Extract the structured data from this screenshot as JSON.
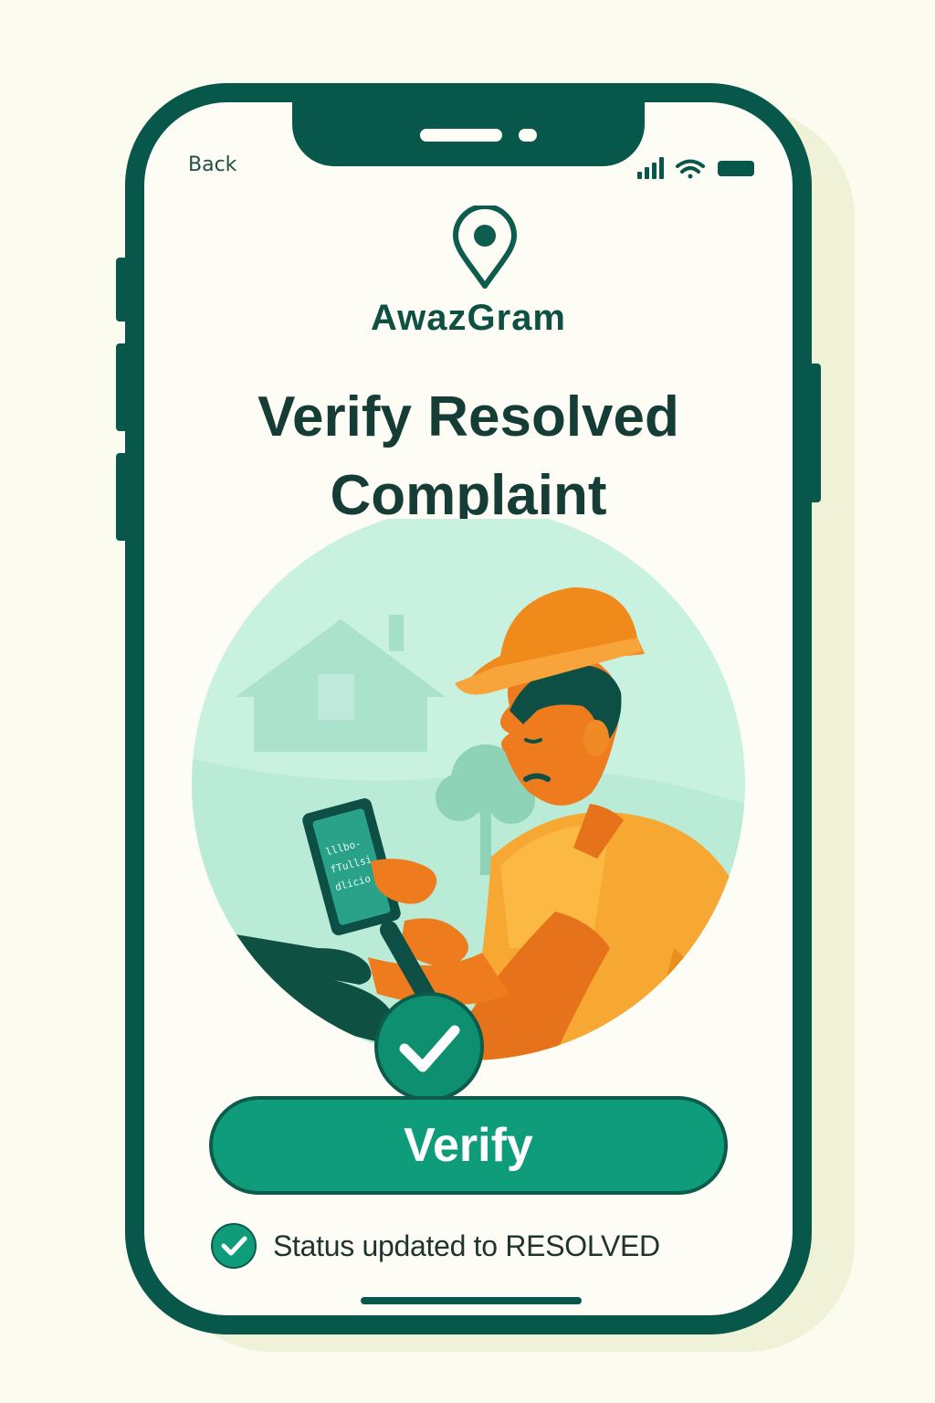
{
  "nav": {
    "back_label": "Back"
  },
  "status_bar": {
    "icons": [
      "signal-icon",
      "wifi-icon",
      "battery-icon"
    ]
  },
  "app": {
    "logo_icon": "location-pin-icon",
    "name": "AwazGram"
  },
  "page": {
    "title_line1": "Verify Resolved",
    "title_line2": "Complaint"
  },
  "illustration": {
    "subject": "worker-verifying-on-phone",
    "phone_screen_lines": [
      "lllbo-",
      "fTullsi",
      "dlicio"
    ]
  },
  "actions": {
    "verify_label": "Verify"
  },
  "status": {
    "icon": "check-circle-icon",
    "text": "Status updated to RESOLVED"
  },
  "colors": {
    "primary": "#0e9c7b",
    "frame": "#07574a",
    "title": "#163d35",
    "worker_shirt": "#f7a832",
    "helmet": "#f08a1a",
    "background": "#fcfbef"
  }
}
